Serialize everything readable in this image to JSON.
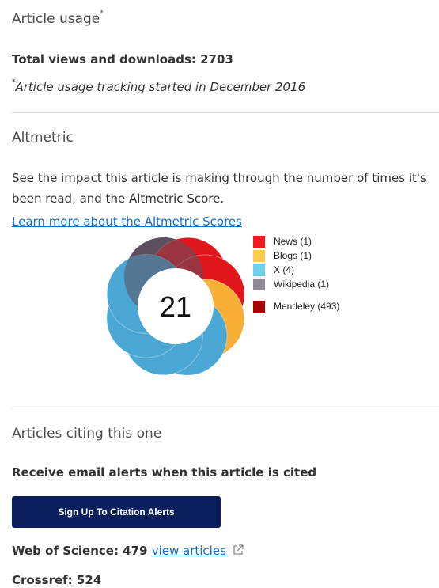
{
  "usage": {
    "heading": "Article usage",
    "heading_marker": "*",
    "total_label": "Total views and downloads: 2703",
    "note_marker": "*",
    "note": "Article usage tracking started in December 2016"
  },
  "altmetric": {
    "heading": "Altmetric",
    "description": "See the impact this article is making through the number of times it's been read, and the Altmetric Score.",
    "learn_more_link": "Learn more about the Altmetric Scores",
    "score": "21",
    "legend": [
      {
        "label": "News (1)",
        "color": "#ee1c1c"
      },
      {
        "label": "Blogs (1)",
        "color": "#fbcc4d"
      },
      {
        "label": "X (4)",
        "color": "#74cfed"
      },
      {
        "label": "Wikipedia (1)",
        "color": "#928a96"
      },
      {
        "label": "Mendeley (493)",
        "color": "#a60000"
      }
    ],
    "donut_colors": {
      "news": "#e0161a",
      "blogs": "#f7b035",
      "x": "#4aa7d3",
      "wikipedia": "#5c5160"
    }
  },
  "citing": {
    "heading": "Articles citing this one",
    "alert_text": "Receive email alerts when this article is cited",
    "button_label": "Sign Up To Citation Alerts",
    "wos_label": "Web of Science: 479",
    "wos_link": "view articles",
    "crossref_label": "Crossref: 524"
  }
}
